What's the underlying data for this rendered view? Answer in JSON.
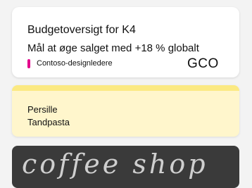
{
  "cards": [
    {
      "title": "Budgetoversigt for K4",
      "subtitle": "Mål at øge salget med +18 % globalt",
      "tag": {
        "label": "Contoso-designledere",
        "color": "#e3008c"
      },
      "initials": "GCO"
    },
    {
      "accent_color": "#fbe982",
      "items": [
        "Persille",
        "Tandpasta"
      ]
    },
    {
      "image_text": "coffee shop"
    }
  ]
}
